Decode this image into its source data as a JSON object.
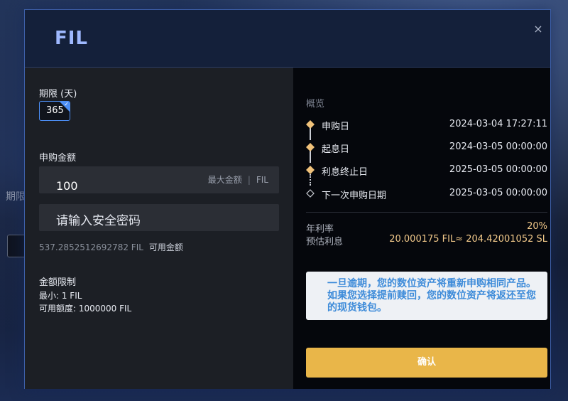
{
  "backdrop": {
    "partial_text": "期限"
  },
  "modal": {
    "title": "FIL",
    "close_glyph": "×"
  },
  "form": {
    "period_label": "期限 (天)",
    "period_value": "365",
    "amount_label": "申购金额",
    "amount_value": "100",
    "amount_max_label": "最大金额",
    "amount_separator": "|",
    "amount_unit": "FIL",
    "password_placeholder": "请输入安全密码",
    "balance_value": "537.2852512692782 FIL",
    "balance_label": "可用金额",
    "limit_title": "金额限制",
    "limit_min": "最小: 1 FIL",
    "limit_available": "可用额度: 1000000 FIL"
  },
  "overview": {
    "title": "概览",
    "timeline": [
      {
        "label": "申购日",
        "value": "2024-03-04 17:27:11"
      },
      {
        "label": "起息日",
        "value": "2024-03-05 00:00:00"
      },
      {
        "label": "利息终止日",
        "value": "2025-03-05 00:00:00"
      },
      {
        "label": "下一次申购日期",
        "value": "2025-03-05 00:00:00"
      }
    ],
    "annual_rate_label": "年利率",
    "annual_rate_value": "20%",
    "est_interest_label": "预估利息",
    "est_interest_value": "20.000175 FIL≈ 204.42001052 SL",
    "notice": "一旦逾期，您的数位资产将重新申购相同产品。如果您选择提前赎回，您的数位资产将返还至您的现货钱包。",
    "confirm_label": "确认"
  },
  "colors": {
    "accent_blue": "#4c8ef5",
    "gold": "#e9b649",
    "rate_text": "#f2c98a",
    "notice_text": "#3d8bd9"
  }
}
